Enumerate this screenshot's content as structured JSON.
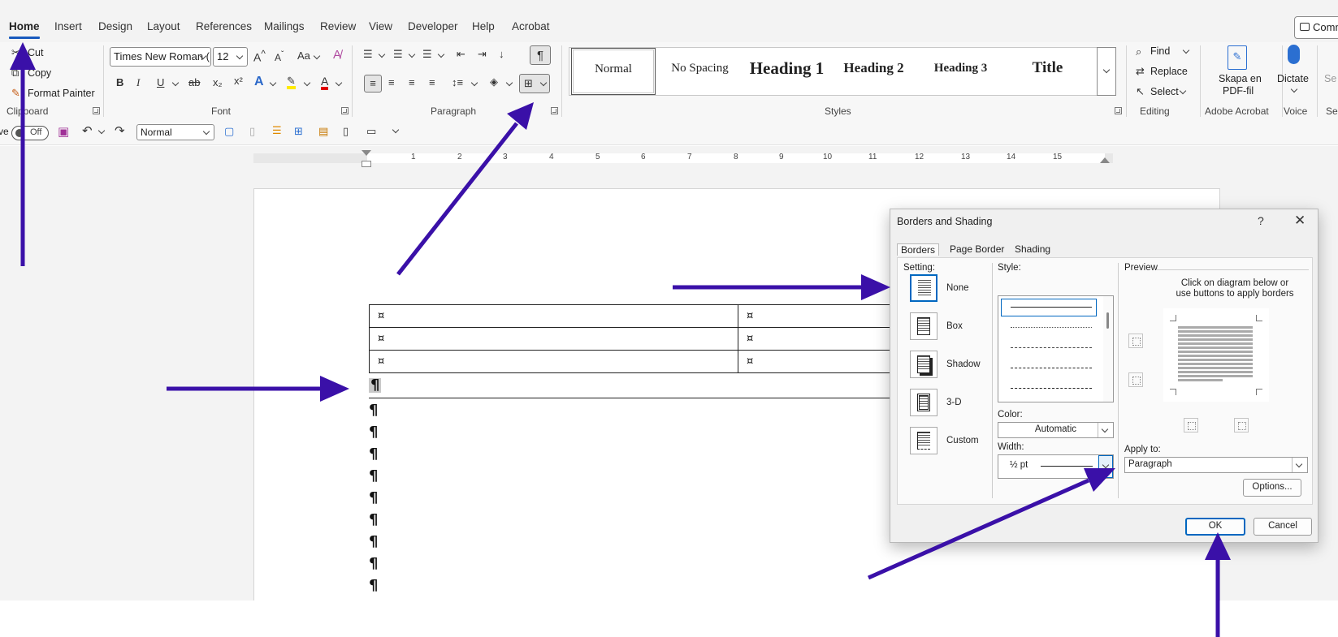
{
  "menu": {
    "tabs": [
      "Home",
      "Insert",
      "Design",
      "Layout",
      "References",
      "Mailings",
      "Review",
      "View",
      "Developer",
      "Help",
      "Acrobat"
    ],
    "comments_label": "Comm"
  },
  "ribbon": {
    "clipboard": {
      "cut": "Cut",
      "copy": "Copy",
      "format_painter": "Format Painter",
      "label": "Clipboard"
    },
    "font": {
      "name": "Times New Roman (",
      "size": "12",
      "label": "Font"
    },
    "paragraph": {
      "label": "Paragraph"
    },
    "styles": {
      "items": [
        "Normal",
        "No Spacing",
        "Heading 1",
        "Heading 2",
        "Heading 3",
        "Title"
      ],
      "label": "Styles"
    },
    "editing": {
      "find": "Find",
      "replace": "Replace",
      "select": "Select",
      "label": "Editing"
    },
    "acrobat": {
      "line1": "Skapa en",
      "line2": "PDF-fil",
      "label": "Adobe Acrobat"
    },
    "voice": {
      "dictate": "Dictate",
      "label": "Voice"
    },
    "sensitivity_partial": "Se"
  },
  "qat": {
    "autosave_prefix": "ve",
    "toggle": "Off",
    "style_value": "Normal"
  },
  "ruler": {
    "numbers": [
      "1",
      "2",
      "3",
      "4",
      "5",
      "6",
      "7",
      "8",
      "9",
      "10",
      "11",
      "12",
      "13",
      "14",
      "15"
    ]
  },
  "document": {
    "table_cell_marker": "¤",
    "paragraph_mark": "¶"
  },
  "dialog": {
    "title": "Borders and Shading",
    "help": "?",
    "tabs": [
      "Borders",
      "Page Border",
      "Shading"
    ],
    "setting_label": "Setting:",
    "settings": [
      "None",
      "Box",
      "Shadow",
      "3-D",
      "Custom"
    ],
    "style_label": "Style:",
    "color_label": "Color:",
    "color_value": "Automatic",
    "width_label": "Width:",
    "width_value": "½ pt",
    "preview_label": "Preview",
    "preview_hint_1": "Click on diagram below or",
    "preview_hint_2": "use buttons to apply borders",
    "apply_to_label": "Apply to:",
    "apply_to_value": "Paragraph",
    "options_button": "Options...",
    "ok_button": "OK",
    "cancel_button": "Cancel"
  },
  "colors": {
    "accent": "#185abd",
    "arrow": "#3a10a8",
    "dialog_focus": "#0067c0"
  }
}
